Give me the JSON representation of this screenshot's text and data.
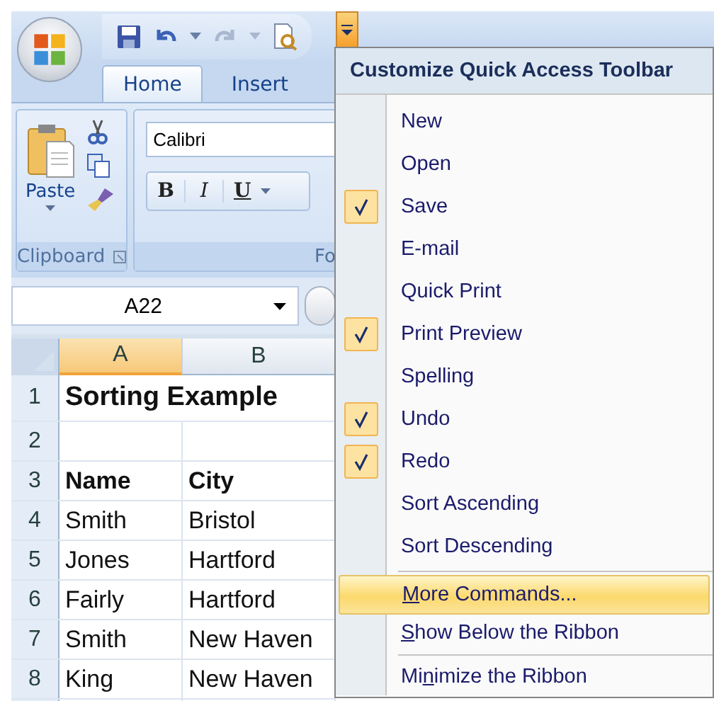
{
  "quick_access": {
    "customize_open": true
  },
  "tabs": [
    {
      "label": "Home",
      "selected": true
    },
    {
      "label": "Insert",
      "selected": false
    }
  ],
  "ribbon": {
    "paste_label": "Paste",
    "clipboard_label": "Clipboard",
    "font_name": "Calibri",
    "bold": "B",
    "italic": "I",
    "underline": "U",
    "font_label": "Fo"
  },
  "name_box": "A22",
  "sheet": {
    "columns": [
      {
        "label": "A",
        "selected": true
      },
      {
        "label": "B",
        "selected": false
      }
    ],
    "rows": [
      {
        "number": "1",
        "kind": "title",
        "cells": [
          "Sorting Example"
        ]
      },
      {
        "number": "2",
        "kind": "data",
        "cells": [
          "",
          ""
        ]
      },
      {
        "number": "3",
        "kind": "header",
        "cells": [
          "Name",
          "City"
        ]
      },
      {
        "number": "4",
        "kind": "data",
        "cells": [
          "Smith",
          "Bristol"
        ]
      },
      {
        "number": "5",
        "kind": "data",
        "cells": [
          "Jones",
          "Hartford"
        ]
      },
      {
        "number": "6",
        "kind": "data",
        "cells": [
          "Fairly",
          "Hartford"
        ]
      },
      {
        "number": "7",
        "kind": "data",
        "cells": [
          "Smith",
          "New Haven"
        ]
      },
      {
        "number": "8",
        "kind": "data",
        "cells": [
          "King",
          "New Haven"
        ]
      }
    ]
  },
  "menu": {
    "title": "Customize Quick Access Toolbar",
    "items": [
      {
        "label": "New",
        "checked": false
      },
      {
        "label": "Open",
        "checked": false
      },
      {
        "label": "Save",
        "checked": true
      },
      {
        "label": "E-mail",
        "checked": false
      },
      {
        "label": "Quick Print",
        "checked": false
      },
      {
        "label": "Print Preview",
        "checked": true
      },
      {
        "label": "Spelling",
        "checked": false
      },
      {
        "label": "Undo",
        "checked": true
      },
      {
        "label": "Redo",
        "checked": true
      },
      {
        "label": "Sort Ascending",
        "checked": false
      },
      {
        "label": "Sort Descending",
        "checked": false
      }
    ],
    "commands": [
      {
        "accel": "M",
        "after": "ore Commands...",
        "selected": true,
        "separator_before": true
      },
      {
        "accel": "S",
        "after": "how Below the Ribbon",
        "selected": false,
        "separator_before": false
      },
      {
        "before": "Mi",
        "accel": "n",
        "after": "imize the Ribbon",
        "selected": false,
        "separator_before": true
      }
    ]
  }
}
